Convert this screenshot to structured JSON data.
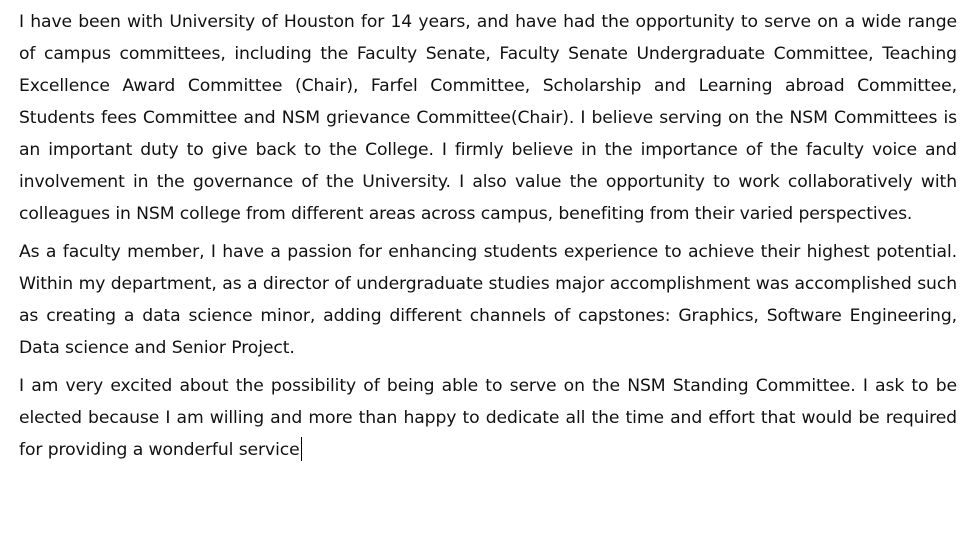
{
  "document": {
    "paragraphs": [
      "I have been with University of Houston for 14 years, and have had the opportunity to serve on a wide range of campus committees, including the Faculty Senate, Faculty Senate Undergraduate Committee, Teaching Excellence Award Committee (Chair), Farfel Committee, Scholarship and Learning abroad Committee, Students fees Committee and NSM grievance Committee(Chair). I believe serving on the NSM Committees is an important duty to give back to the College. I firmly believe in the importance of the faculty voice and involvement in the governance of the University. I also value the opportunity to work collaboratively with colleagues in NSM college from different areas across campus, benefiting from their varied perspectives.",
      "As a faculty member, I have a passion for enhancing students experience to achieve their highest potential. Within my department, as a director of undergraduate studies major accomplishment was accomplished such as creating a data science minor, adding different channels of capstones: Graphics, Software Engineering, Data science and Senior Project.",
      "I am very excited about the possibility of being able to serve on the NSM Standing Committee. I ask to be elected because I am willing and more than happy to dedicate all the time and effort that would be required for providing a wonderful service"
    ]
  }
}
